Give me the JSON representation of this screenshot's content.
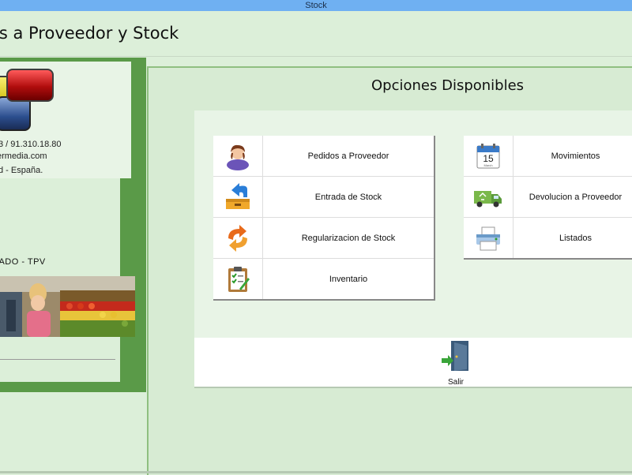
{
  "window": {
    "title": "Stock"
  },
  "header": {
    "title": "os a Proveedor y Stock"
  },
  "company": {
    "phone": "3 / 91.310.18.80",
    "web": "ermedia.com",
    "city": "d - España.",
    "tpv_label": "CADO - TPV"
  },
  "options": {
    "title": "Opciones Disponibles",
    "left_buttons": [
      {
        "label": "Pedidos a Proveedor",
        "icon": "person-icon"
      },
      {
        "label": "Entrada de Stock",
        "icon": "stock-entry-icon"
      },
      {
        "label": "Regularizacion de Stock",
        "icon": "refresh-arrows-icon"
      },
      {
        "label": "Inventario",
        "icon": "clipboard-icon"
      }
    ],
    "right_buttons": [
      {
        "label": "Movimientos",
        "icon": "calendar-icon",
        "calendar_day": "15",
        "calendar_month": "March"
      },
      {
        "label": "Devolucion a Proveedor",
        "icon": "delivery-truck-icon"
      },
      {
        "label": "Listados",
        "icon": "printer-icon"
      }
    ]
  },
  "footer": {
    "exit_label": "Salir"
  },
  "colors": {
    "panel_border": "#5a9a48",
    "background": "#dcefd9",
    "titlebar": "#6fb0f2"
  }
}
